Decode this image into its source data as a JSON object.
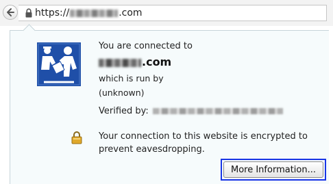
{
  "address_bar": {
    "url_prefix": "https://",
    "url_suffix": ".com"
  },
  "identity_popup": {
    "connected_to": "You are connected to",
    "host_suffix": ".com",
    "run_by": "which is run by",
    "owner": "(unknown)",
    "verified_by": "Verified by:",
    "encryption_message": "Your connection to this website is encrypted to prevent eavesdropping.",
    "more_info_label": "More Information..."
  },
  "colors": {
    "identity_icon_bg": "#1f4fa8",
    "highlight_border": "#1734e6"
  },
  "icons": {
    "back": "back-arrow-icon",
    "secure": "lock-icon",
    "identity": "identity-verification-icon",
    "encryption": "padlock-icon"
  }
}
